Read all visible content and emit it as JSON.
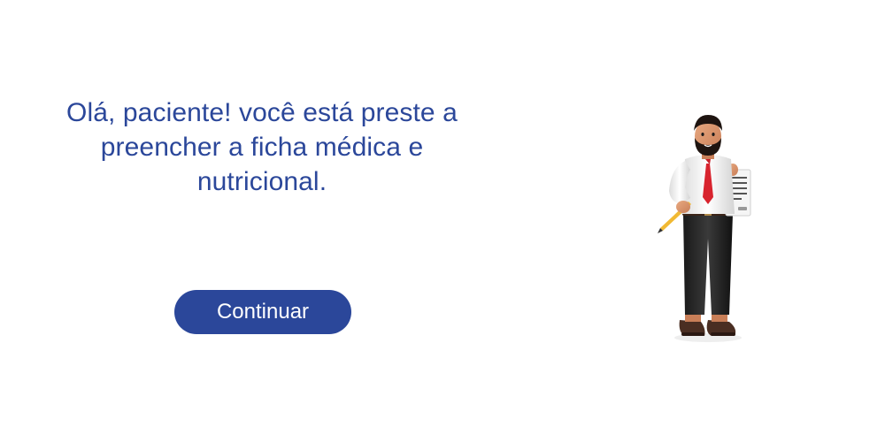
{
  "intro": {
    "greeting": "Olá, paciente! você está preste a preencher a ficha médica e nutricional."
  },
  "actions": {
    "continue_label": "Continuar"
  },
  "illustration": {
    "icon": "doctor-holding-clipboard-illustration"
  },
  "colors": {
    "brand": "#2b479a",
    "background": "#ffffff",
    "button_text": "#ffffff"
  }
}
